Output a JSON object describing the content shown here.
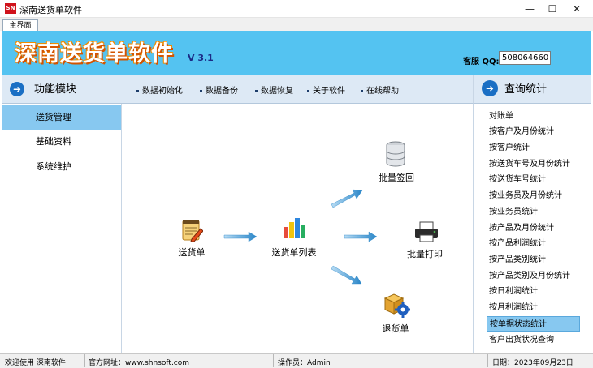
{
  "window": {
    "title": "深南送货单软件",
    "app_icon": "SN",
    "minimize": "—",
    "maximize": "☐",
    "close": "✕"
  },
  "tabs": {
    "main": "主界面"
  },
  "header": {
    "title": "深南送货单软件",
    "version": "V 3.1",
    "qq_label": "客服 QQ:",
    "qq_value": "508064660"
  },
  "left": {
    "title": "功能模块",
    "items": [
      {
        "label": "送货管理"
      },
      {
        "label": "基础资料"
      },
      {
        "label": "系统维护"
      }
    ]
  },
  "toolbar": {
    "items": [
      {
        "label": "数据初始化"
      },
      {
        "label": "数据备份"
      },
      {
        "label": "数据恢复"
      },
      {
        "label": "关于软件"
      },
      {
        "label": "在线帮助"
      }
    ]
  },
  "flow": {
    "delivery": "送货单",
    "list": "送货单列表",
    "batch_sign": "批量签回",
    "batch_print": "批量打印",
    "return": "退货单"
  },
  "right": {
    "title": "查询统计",
    "items": [
      {
        "label": "对账单"
      },
      {
        "label": "按客户及月份统计"
      },
      {
        "label": "按客户统计"
      },
      {
        "label": "按送货车号及月份统计"
      },
      {
        "label": "按送货车号统计"
      },
      {
        "label": "按业务员及月份统计"
      },
      {
        "label": "按业务员统计"
      },
      {
        "label": "按产品及月份统计"
      },
      {
        "label": "按产品利润统计"
      },
      {
        "label": "按产品类别统计"
      },
      {
        "label": "按产品类别及月份统计"
      },
      {
        "label": "按日利润统计"
      },
      {
        "label": "按月利润统计"
      },
      {
        "label": "按单据状态统计"
      },
      {
        "label": "客户出货状况查询"
      }
    ]
  },
  "status": {
    "welcome": "欢迎使用 深南软件",
    "website": "官方网址：www.shnsoft.com",
    "operator": "操作员：Admin",
    "date": "日期：2023年09月23日"
  }
}
